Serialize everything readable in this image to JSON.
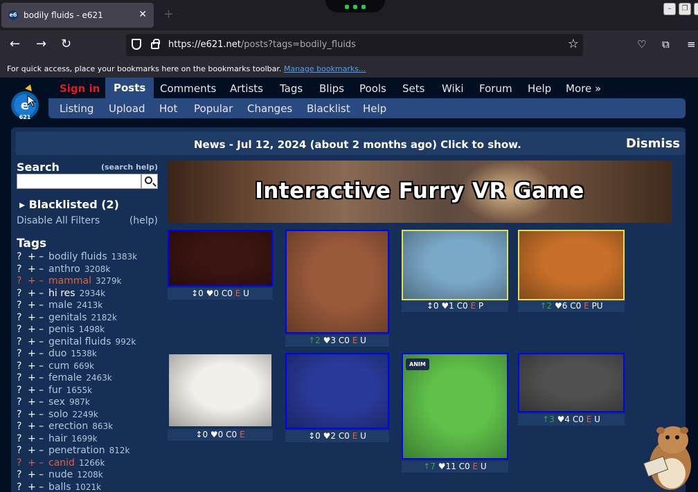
{
  "browser": {
    "tab_title": "bodily fluids - e621",
    "tab_favicon": "e6",
    "url_host": "https://e621.net",
    "url_rest": "/posts?tags=bodily_fluids",
    "bookmarks_hint": "For quick access, place your bookmarks here on the bookmarks toolbar.",
    "bookmarks_link": "Manage bookmarks..."
  },
  "nav": {
    "signin": "Sign in",
    "items": [
      "Posts",
      "Comments",
      "Artists",
      "Tags",
      "Blips",
      "Pools",
      "Sets",
      "Wiki",
      "Forum",
      "Help",
      "More »"
    ],
    "sub": [
      "Listing",
      "Upload",
      "Hot",
      "Popular",
      "Changes",
      "Blacklist",
      "Help"
    ]
  },
  "news": {
    "message": "News - Jul 12, 2024 (about 2 months ago) Click to show.",
    "dismiss": "Dismiss"
  },
  "sidebar": {
    "search_heading": "Search",
    "search_help": "(search help)",
    "blacklisted": "Blacklisted (2)",
    "disable_filters": "Disable All Filters",
    "help": "(help)",
    "tags_heading": "Tags",
    "tags": [
      {
        "name": "bodily fluids",
        "count": "1383k",
        "style": "normal"
      },
      {
        "name": "anthro",
        "count": "3208k",
        "style": "normal"
      },
      {
        "name": "mammal",
        "count": "3279k",
        "style": "red"
      },
      {
        "name": "hi res",
        "count": "2934k",
        "style": "white"
      },
      {
        "name": "male",
        "count": "2413k",
        "style": "normal"
      },
      {
        "name": "genitals",
        "count": "2182k",
        "style": "normal"
      },
      {
        "name": "penis",
        "count": "1498k",
        "style": "normal"
      },
      {
        "name": "genital fluids",
        "count": "992k",
        "style": "normal"
      },
      {
        "name": "duo",
        "count": "1538k",
        "style": "normal"
      },
      {
        "name": "cum",
        "count": "669k",
        "style": "normal"
      },
      {
        "name": "female",
        "count": "2463k",
        "style": "normal"
      },
      {
        "name": "fur",
        "count": "1655k",
        "style": "normal"
      },
      {
        "name": "sex",
        "count": "987k",
        "style": "normal"
      },
      {
        "name": "solo",
        "count": "2249k",
        "style": "normal"
      },
      {
        "name": "erection",
        "count": "863k",
        "style": "normal"
      },
      {
        "name": "hair",
        "count": "1699k",
        "style": "normal"
      },
      {
        "name": "penetration",
        "count": "812k",
        "style": "normal"
      },
      {
        "name": "canid",
        "count": "1266k",
        "style": "red"
      },
      {
        "name": "nude",
        "count": "1208k",
        "style": "normal"
      },
      {
        "name": "balls",
        "count": "1021k",
        "style": "normal"
      }
    ]
  },
  "banner": {
    "text": "Interactive Furry VR Game"
  },
  "posts": [
    {
      "score": "↕0",
      "favs": "♥0",
      "comments": "C0",
      "rating": "E",
      "flags": "U",
      "up": false,
      "border": "blue",
      "color": "#3a1410"
    },
    {
      "score": "↑2",
      "favs": "♥3",
      "comments": "C0",
      "rating": "E",
      "flags": "U",
      "up": true,
      "border": "blue",
      "color": "#9a5a3a"
    },
    {
      "score": "↕0",
      "favs": "♥1",
      "comments": "C0",
      "rating": "E",
      "flags": "P",
      "up": false,
      "border": "yellow",
      "color": "#7aa8c8"
    },
    {
      "score": "↑2",
      "favs": "♥6",
      "comments": "C0",
      "rating": "E",
      "flags": "PU",
      "up": true,
      "border": "yellow",
      "color": "#c8702a"
    },
    {
      "score": "↕0",
      "favs": "♥0",
      "comments": "C0",
      "rating": "E",
      "flags": "",
      "up": false,
      "border": "none",
      "color": "#f2f0ea"
    },
    {
      "score": "↕0",
      "favs": "♥2",
      "comments": "C0",
      "rating": "E",
      "flags": "U",
      "up": false,
      "border": "blue",
      "color": "#2a3a9a"
    },
    {
      "score": "↑7",
      "favs": "♥11",
      "comments": "C0",
      "rating": "E",
      "flags": "U",
      "up": true,
      "border": "blue",
      "color": "#5fc04a",
      "anim": "ANIM"
    },
    {
      "score": "↑3",
      "favs": "♥4",
      "comments": "C0",
      "rating": "E",
      "flags": "U",
      "up": true,
      "border": "blue",
      "color": "#505050"
    }
  ]
}
